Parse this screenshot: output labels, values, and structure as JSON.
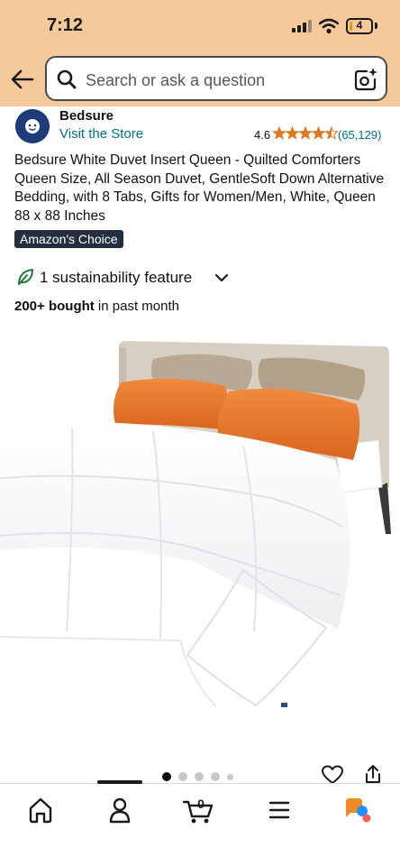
{
  "status_bar": {
    "time": "7:12",
    "battery": "4"
  },
  "search": {
    "placeholder": "Search or ask a question"
  },
  "store": {
    "name": "Bedsure",
    "link": "Visit the Store"
  },
  "rating": {
    "value": "4.6",
    "stars": 4.5,
    "count": "(65,129)"
  },
  "product": {
    "title": "Bedsure White Duvet Insert Queen - Quilted Comforters Queen Size, All Season Duvet, GentleSoft Down Alternative Bedding, with 8 Tabs, Gifts for Women/Men, White, Queen 88 x 88 Inches",
    "badge": "Amazon's Choice",
    "sustainability": "1 sustainability feature",
    "bought_bold": "200+ bought",
    "bought_rest": " in past month",
    "image_count": 5,
    "active_image": 1
  },
  "nav": {
    "items": [
      "home-icon",
      "account-icon",
      "cart-icon",
      "menu-icon",
      "rufus-icon"
    ],
    "cart_count": "0"
  },
  "colors": {
    "header_bg": "#F5C99A",
    "link": "#007185",
    "star": "#DE7921",
    "badge_bg": "#232F3E"
  }
}
